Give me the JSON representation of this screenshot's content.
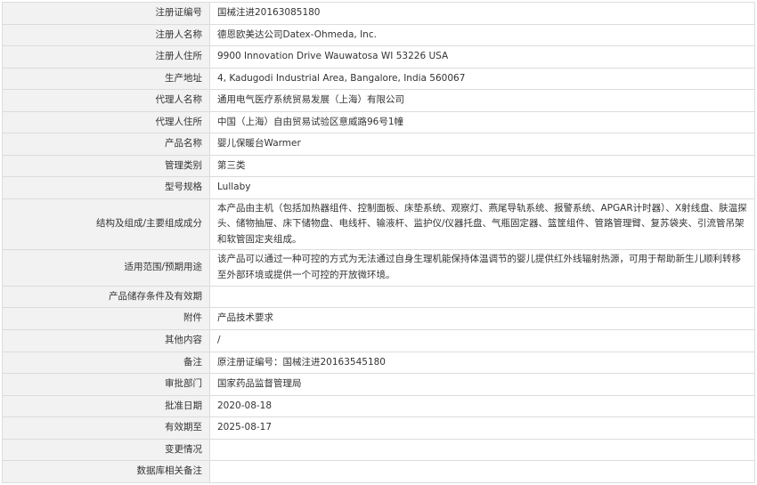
{
  "rows": [
    {
      "label": "注册证编号",
      "value": "国械注进20163085180"
    },
    {
      "label": "注册人名称",
      "value": "德恩欧美达公司Datex-Ohmeda, Inc."
    },
    {
      "label": "注册人住所",
      "value": "9900 Innovation Drive Wauwatosa WI 53226 USA"
    },
    {
      "label": "生产地址",
      "value": "4, Kadugodi Industrial Area, Bangalore, India 560067"
    },
    {
      "label": "代理人名称",
      "value": "通用电气医疗系统贸易发展（上海）有限公司"
    },
    {
      "label": "代理人住所",
      "value": "中国（上海）自由贸易试验区意威路96号1幢"
    },
    {
      "label": "产品名称",
      "value": "婴儿保暖台Warmer"
    },
    {
      "label": "管理类别",
      "value": "第三类"
    },
    {
      "label": "型号规格",
      "value": "Lullaby"
    },
    {
      "label": "结构及组成/主要组成成分",
      "value": "本产品由主机（包括加热器组件、控制面板、床垫系统、观察灯、燕尾导轨系统、报警系统、APGAR计时器）、X射线盘、肤温探头、储物抽屉、床下储物盘、电线杆、输液杆、监护仪/仪器托盘、气瓶固定器、篮筐组件、管路管理臂、复苏袋夹、引流管吊架和软管固定夹组成。"
    },
    {
      "label": "适用范围/预期用途",
      "value": "该产品可以通过一种可控的方式为无法通过自身生理机能保持体温调节的婴儿提供红外线辐射热源，可用于帮助新生儿顺利转移至外部环境或提供一个可控的开放微环境。"
    },
    {
      "label": "产品储存条件及有效期",
      "value": ""
    },
    {
      "label": "附件",
      "value": "产品技术要求"
    },
    {
      "label": "其他内容",
      "value": "/"
    },
    {
      "label": "备注",
      "value": "原注册证编号：国械注进20163545180"
    },
    {
      "label": "审批部门",
      "value": "国家药品监督管理局"
    },
    {
      "label": "批准日期",
      "value": "2020-08-18"
    },
    {
      "label": "有效期至",
      "value": "2025-08-17"
    },
    {
      "label": "变更情况",
      "value": ""
    },
    {
      "label": "数据库相关备注",
      "value": ""
    }
  ]
}
